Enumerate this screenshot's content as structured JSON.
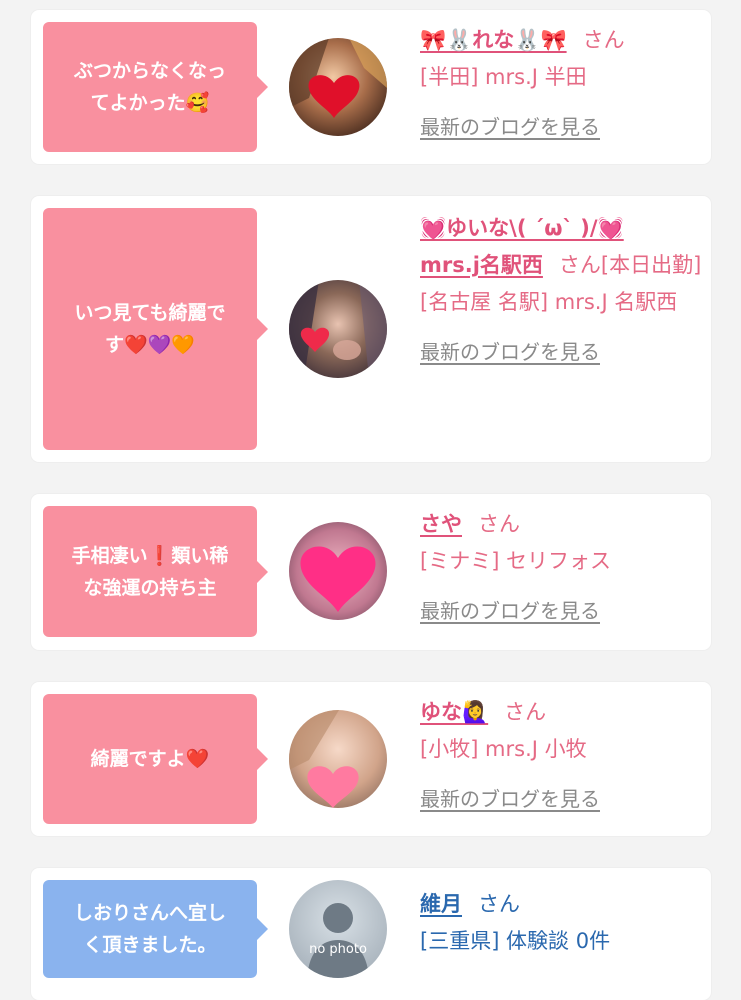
{
  "reviews": [
    {
      "comment": "ぶつからなくなってよかった🥰",
      "comment_lines": [
        "ぶつからなくなっ",
        "てよかった🥰"
      ],
      "girl_name": "🎀🐰れな🐰🎀",
      "san": "さん",
      "extra": "",
      "shop": "[半田] mrs.J 半田",
      "blog_link": "最新のブログを見る",
      "avatar_icon": "heart-sticker-icon"
    },
    {
      "comment": "いつ見ても綺麗です❤️💜🧡",
      "comment_lines": [
        "いつ見ても綺麗で",
        "す❤️💜🧡"
      ],
      "girl_name": "💓ゆいな\\( ´ω` )/💓mrs.j名駅西",
      "name_lines": [
        "💓ゆいな\\( ´ω` )/💓",
        "mrs.j名駅西"
      ],
      "san": "さん",
      "extra": "[本日出勤]",
      "shop": "[名古屋 名駅] mrs.J 名駅西",
      "blog_link": "最新のブログを見る",
      "avatar_icon": "heart-sticker-icon"
    },
    {
      "comment": "手相凄い❗️類い稀な強運の持ち主",
      "comment_lines": [
        "手相凄い❗️類い稀",
        "な強運の持ち主"
      ],
      "girl_name": "さや",
      "san": "さん",
      "extra": "",
      "shop": "[ミナミ] セリフォス",
      "blog_link": "最新のブログを見る",
      "avatar_icon": "heart-sticker-icon"
    },
    {
      "comment": "綺麗ですよ❤️",
      "comment_lines": [
        "綺麗ですよ❤️"
      ],
      "girl_name": "ゆな🙋‍♀️",
      "san": "さん",
      "extra": "",
      "shop": "[小牧] mrs.J 小牧",
      "blog_link": "最新のブログを見る",
      "avatar_icon": "heart-sticker-icon"
    },
    {
      "comment": "しおりさんへ宜しく頂きました。",
      "comment_lines": [
        "しおりさんへ宜し",
        "く頂きました。"
      ],
      "girl_name": "維月",
      "san": "さん",
      "extra": "",
      "shop": "[三重県] 体験談 0件",
      "blog_link": "",
      "avatar_text": "no photo",
      "avatar_icon": "person-silhouette-icon"
    }
  ],
  "colors": {
    "bubble_pink": "#f9909f",
    "bubble_blue": "#8ab3ee",
    "name_pink": "#e0527a",
    "text_pink": "#e56a85",
    "link_gray": "#8a8a8a",
    "name_blue": "#2a68ae"
  }
}
